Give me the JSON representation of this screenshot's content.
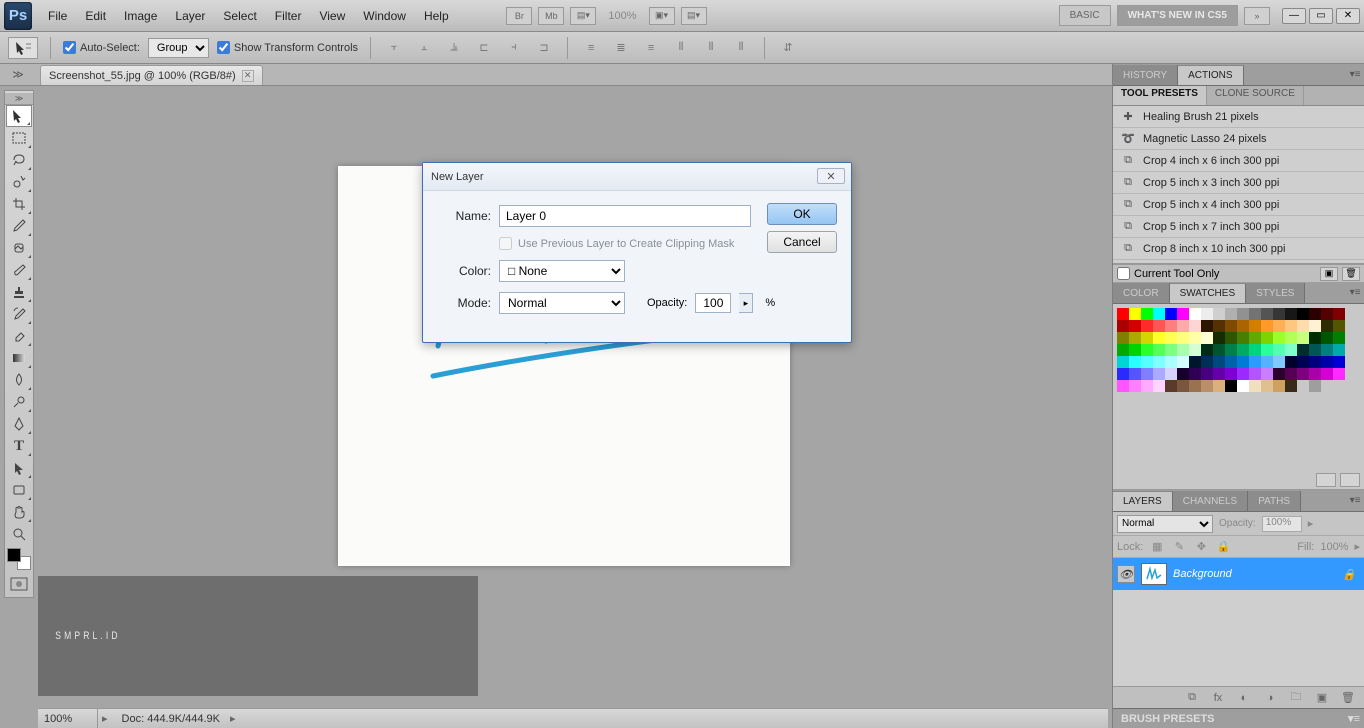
{
  "menubar": {
    "logo_text": "Ps",
    "items": [
      "File",
      "Edit",
      "Image",
      "Layer",
      "Select",
      "Filter",
      "View",
      "Window",
      "Help"
    ],
    "zoom": "100%",
    "workspace_basic": "BASIC",
    "workspace_new": "WHAT'S NEW IN CS5"
  },
  "optbar": {
    "auto_select": "Auto-Select:",
    "auto_select_mode": "Group",
    "show_transform": "Show Transform Controls"
  },
  "doc_tab": {
    "title": "Screenshot_55.jpg @ 100% (RGB/8#)"
  },
  "statusbar": {
    "zoom": "100%",
    "doc_info": "Doc: 444.9K/444.9K"
  },
  "panels": {
    "history": "HISTORY",
    "actions": "ACTIONS",
    "tool_presets": "TOOL PRESETS",
    "clone_source": "CLONE SOURCE",
    "presets": [
      "Healing Brush 21 pixels",
      "Magnetic Lasso 24 pixels",
      "Crop 4 inch x 6 inch 300 ppi",
      "Crop 5 inch x 3 inch 300 ppi",
      "Crop 5 inch x 4 inch 300 ppi",
      "Crop 5 inch x 7 inch 300 ppi",
      "Crop 8 inch x 10 inch 300 ppi"
    ],
    "current_tool_only": "Current Tool Only",
    "color": "COLOR",
    "swatches": "SWATCHES",
    "styles": "STYLES",
    "layers": "LAYERS",
    "channels": "CHANNELS",
    "paths": "PATHS",
    "blend_mode": "Normal",
    "opacity_lbl": "Opacity:",
    "opacity_val": "100%",
    "lock_lbl": "Lock:",
    "fill_lbl": "Fill:",
    "fill_val": "100%",
    "layer_name": "Background",
    "brush_presets": "BRUSH PRESETS"
  },
  "dialog": {
    "title": "New Layer",
    "name_lbl": "Name:",
    "name_val": "Layer 0",
    "ok": "OK",
    "cancel": "Cancel",
    "clip_mask": "Use Previous Layer to Create Clipping Mask",
    "color_lbl": "Color:",
    "color_val": "None",
    "mode_lbl": "Mode:",
    "mode_val": "Normal",
    "opacity_lbl": "Opacity:",
    "opacity_val": "100",
    "percent": "%"
  },
  "watermark": "SMPRL.ID",
  "swatch_colors": [
    "#ff0000",
    "#ffff00",
    "#00ff00",
    "#00ffff",
    "#0000ff",
    "#ff00ff",
    "#ffffff",
    "#ededed",
    "#cfcfcf",
    "#b0b0b0",
    "#919191",
    "#737373",
    "#545454",
    "#363636",
    "#171717",
    "#000000",
    "#2c0000",
    "#550000",
    "#7f0000",
    "#aa0000",
    "#d40000",
    "#ff2a2a",
    "#ff5555",
    "#ff7f7f",
    "#ffaaaa",
    "#ffd4d4",
    "#2c1600",
    "#553000",
    "#7f4b00",
    "#aa6400",
    "#d47e00",
    "#ff9a2a",
    "#ffb055",
    "#ffc67f",
    "#ffdcaa",
    "#fff2d4",
    "#2c2c00",
    "#555500",
    "#7f7f00",
    "#aaaa00",
    "#d4d400",
    "#ffff2a",
    "#ffff55",
    "#ffff7f",
    "#ffffaa",
    "#ffffd4",
    "#162c00",
    "#2f5500",
    "#497f00",
    "#63aa00",
    "#7cd400",
    "#9bff2a",
    "#b2ff55",
    "#c9ff7f",
    "#002c00",
    "#005500",
    "#007f00",
    "#00aa00",
    "#00d400",
    "#2aff2a",
    "#55ff55",
    "#7fff7f",
    "#aaffaa",
    "#d4ffd4",
    "#002c16",
    "#00552f",
    "#007f49",
    "#00aa63",
    "#00d47c",
    "#2aff9b",
    "#55ffb2",
    "#7fffc9",
    "#002c2c",
    "#005555",
    "#007f7f",
    "#00aaaa",
    "#00d4d4",
    "#2affff",
    "#55ffff",
    "#7fffff",
    "#aaffff",
    "#d4ffff",
    "#00162c",
    "#002f55",
    "#00497f",
    "#0063aa",
    "#007cd4",
    "#2a9bff",
    "#55b2ff",
    "#7fc9ff",
    "#00002c",
    "#000055",
    "#00007f",
    "#0000aa",
    "#0000d4",
    "#2a2aff",
    "#5555ff",
    "#7f7fff",
    "#aaaaff",
    "#d4d4ff",
    "#16002c",
    "#2f0055",
    "#49007f",
    "#6300aa",
    "#7c00d4",
    "#9b2aff",
    "#b255ff",
    "#c97fff",
    "#2c002c",
    "#550055",
    "#7f007f",
    "#aa00aa",
    "#d400d4",
    "#ff2aff",
    "#ff55ff",
    "#ff7fff",
    "#ffaaff",
    "#ffd4ff",
    "#5a3a2a",
    "#7a563e",
    "#9a7252",
    "#ba8e66",
    "#dab07e",
    "#000000",
    "#ffffff",
    "#f0e0c0",
    "#e0c090",
    "#d0a060",
    "#3a2a1a",
    "#c8c8c8",
    "#9e9e9e"
  ]
}
